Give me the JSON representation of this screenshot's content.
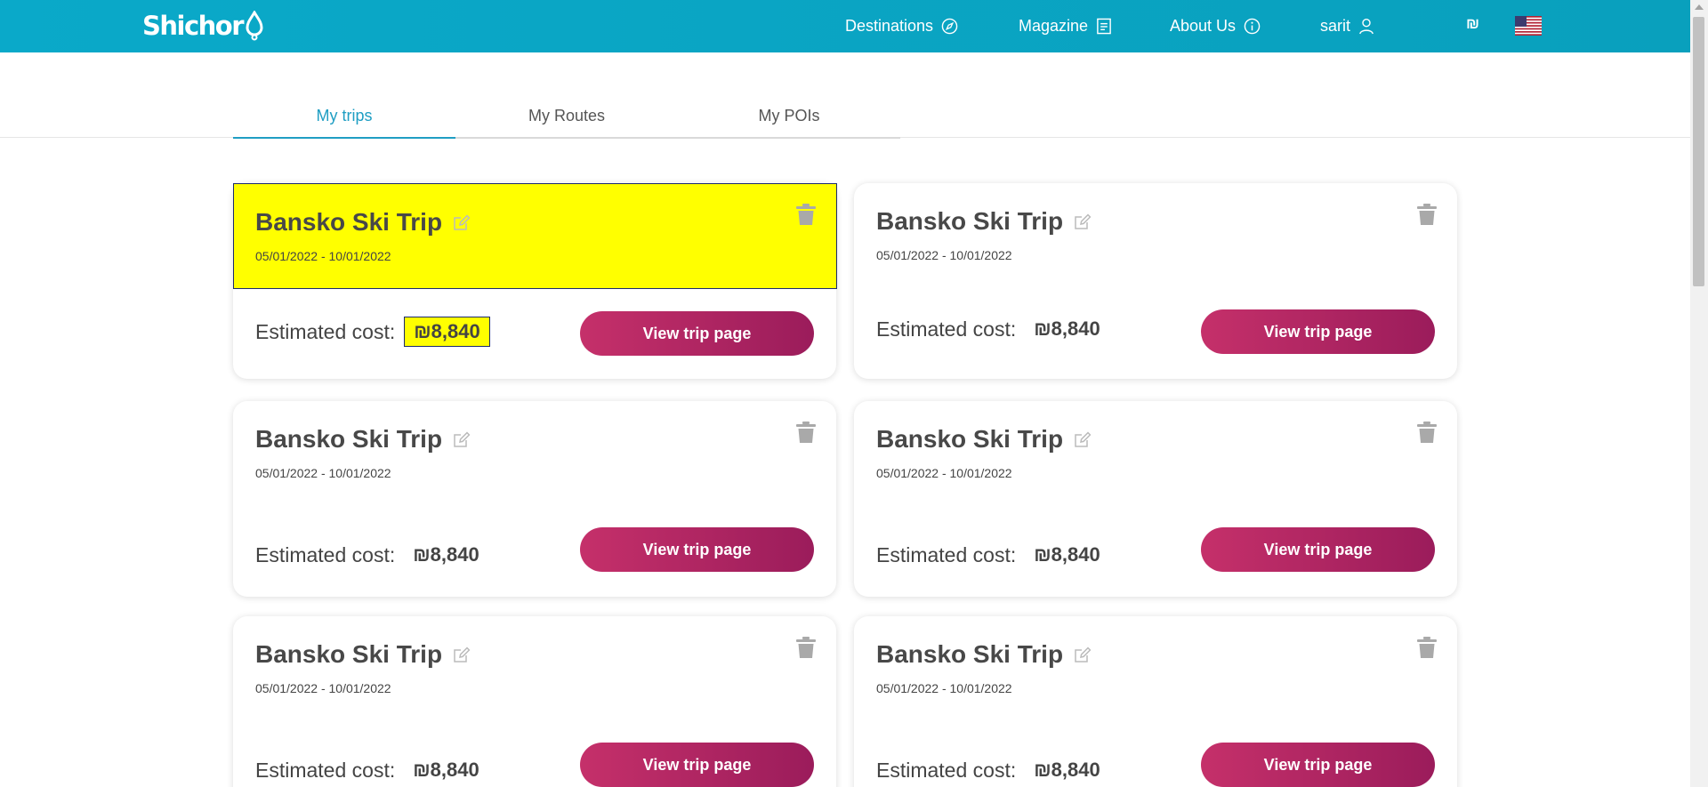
{
  "header": {
    "logo_text": "Shichor",
    "nav": {
      "destinations": "Destinations",
      "magazine": "Magazine",
      "about": "About Us",
      "user": "sarit"
    },
    "currency_symbol": "₪",
    "language_flag": "us-flag-icon",
    "brand_color": "#0aa9c9"
  },
  "tabs": [
    "My trips",
    "My Routes",
    "My POIs"
  ],
  "active_tab": "My trips",
  "accent_color": "#1f9ec3",
  "button_color": "#b42663",
  "highlight_color": "#ffff00",
  "trips": [
    {
      "title": "Bansko Ski Trip",
      "dates": "05/01/2022 - 10/01/2022",
      "cost_label": "Estimated cost:",
      "cost": "₪8,840",
      "button": "View trip page"
    },
    {
      "title": "Bansko Ski Trip",
      "dates": "05/01/2022 - 10/01/2022",
      "cost_label": "Estimated cost:",
      "cost": "₪8,840",
      "button": "View trip page"
    },
    {
      "title": "Bansko Ski Trip",
      "dates": "05/01/2022 - 10/01/2022",
      "cost_label": "Estimated cost:",
      "cost": "₪8,840",
      "button": "View trip page"
    },
    {
      "title": "Bansko Ski Trip",
      "dates": "05/01/2022 - 10/01/2022",
      "cost_label": "Estimated cost:",
      "cost": "₪8,840",
      "button": "View trip page"
    },
    {
      "title": "Bansko Ski Trip",
      "dates": "05/01/2022 - 10/01/2022",
      "cost_label": "Estimated cost:",
      "cost": "₪8,840",
      "button": "View trip page"
    },
    {
      "title": "Bansko Ski Trip",
      "dates": "05/01/2022 - 10/01/2022",
      "cost_label": "Estimated cost:",
      "cost": "₪8,840",
      "button": "View trip page"
    }
  ]
}
